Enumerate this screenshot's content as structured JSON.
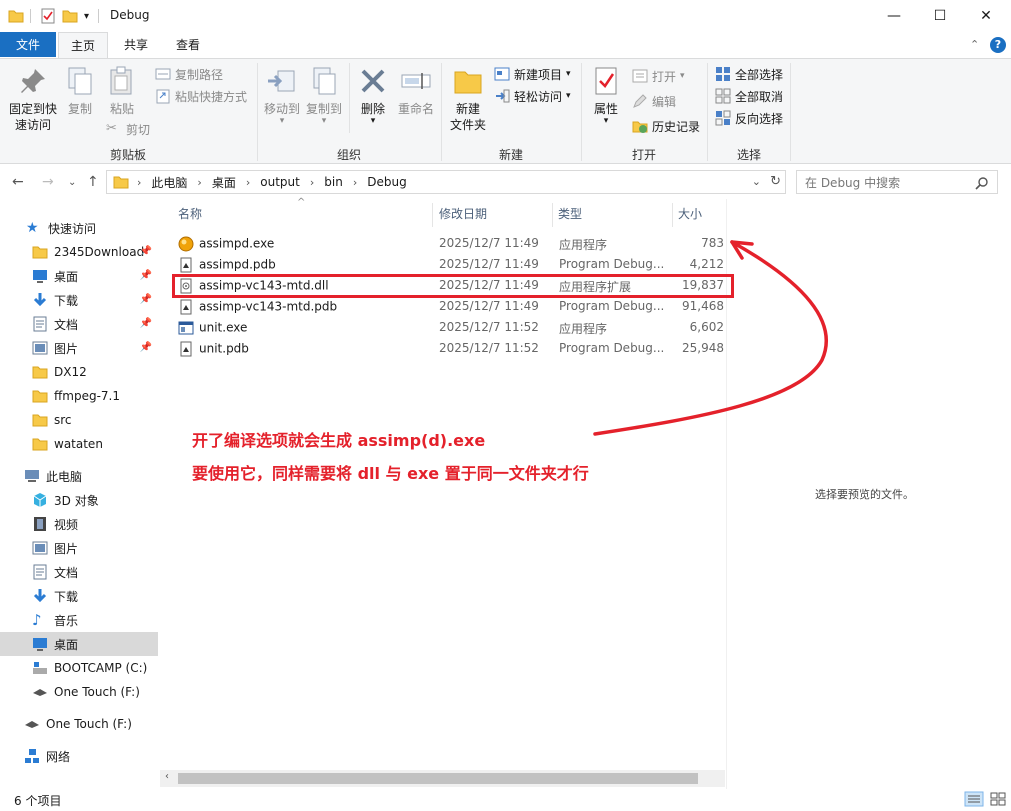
{
  "window": {
    "title": "Debug",
    "minimize": "—",
    "maximize": "☐",
    "close": "✕"
  },
  "tabs": [
    {
      "label": "文件"
    },
    {
      "label": "主页"
    },
    {
      "label": "共享"
    },
    {
      "label": "查看"
    }
  ],
  "ribbon": {
    "clipboard": {
      "pin": "固定到快\n速访问",
      "pin_line1": "固定到快",
      "pin_line2": "速访问",
      "copy": "复制",
      "paste": "粘贴",
      "copy_path": "复制路径",
      "paste_shortcut": "粘贴快捷方式",
      "cut": "剪切",
      "group": "剪贴板"
    },
    "organize": {
      "move_to": "移动到",
      "copy_to": "复制到",
      "delete": "删除",
      "rename": "重命名",
      "group": "组织"
    },
    "new": {
      "new_folder_line1": "新建",
      "new_folder_line2": "文件夹",
      "new_item": "新建项目",
      "easy_access": "轻松访问",
      "group": "新建"
    },
    "open": {
      "properties": "属性",
      "open": "打开",
      "edit": "编辑",
      "history": "历史记录",
      "group": "打开"
    },
    "select": {
      "select_all": "全部选择",
      "select_none": "全部取消",
      "invert": "反向选择",
      "group": "选择"
    }
  },
  "address": {
    "crumbs": [
      "此电脑",
      "桌面",
      "output",
      "bin",
      "Debug"
    ],
    "search_placeholder": "在 Debug 中搜索"
  },
  "nav": {
    "quick_access": "快速访问",
    "quick_items": [
      "2345Download",
      "桌面",
      "下载",
      "文档",
      "图片",
      "DX12",
      "ffmpeg-7.1",
      "src",
      "wataten"
    ],
    "this_pc": "此电脑",
    "pc_items": [
      "3D 对象",
      "视频",
      "图片",
      "文档",
      "下载",
      "音乐",
      "桌面",
      "BOOTCAMP (C:)",
      "One Touch (F:)"
    ],
    "drive": "One Touch (F:)",
    "network": "网络"
  },
  "columns": {
    "name": "名称",
    "modified": "修改日期",
    "type": "类型",
    "size": "大小"
  },
  "files": [
    {
      "name": "assimpd.exe",
      "date": "2025/12/7 11:49",
      "type": "应用程序",
      "size": "783"
    },
    {
      "name": "assimpd.pdb",
      "date": "2025/12/7 11:49",
      "type": "Program Debug...",
      "size": "4,212"
    },
    {
      "name": "assimp-vc143-mtd.dll",
      "date": "2025/12/7 11:49",
      "type": "应用程序扩展",
      "size": "19,837"
    },
    {
      "name": "assimp-vc143-mtd.pdb",
      "date": "2025/12/7 11:49",
      "type": "Program Debug...",
      "size": "91,468"
    },
    {
      "name": "unit.exe",
      "date": "2025/12/7 11:52",
      "type": "应用程序",
      "size": "6,602"
    },
    {
      "name": "unit.pdb",
      "date": "2025/12/7 11:52",
      "type": "Program Debug...",
      "size": "25,948"
    }
  ],
  "preview": {
    "message": "选择要预览的文件。"
  },
  "status": {
    "count": "6 个项目"
  },
  "annotation": {
    "line1": "开了编译选项就会生成 assimp(d).exe",
    "line2": "要使用它，同样需要将 dll 与 exe 置于同一文件夹才行"
  },
  "colors": {
    "accent": "#1a6fc2",
    "annotation": "#e4212b",
    "folder": "#f7c948"
  }
}
